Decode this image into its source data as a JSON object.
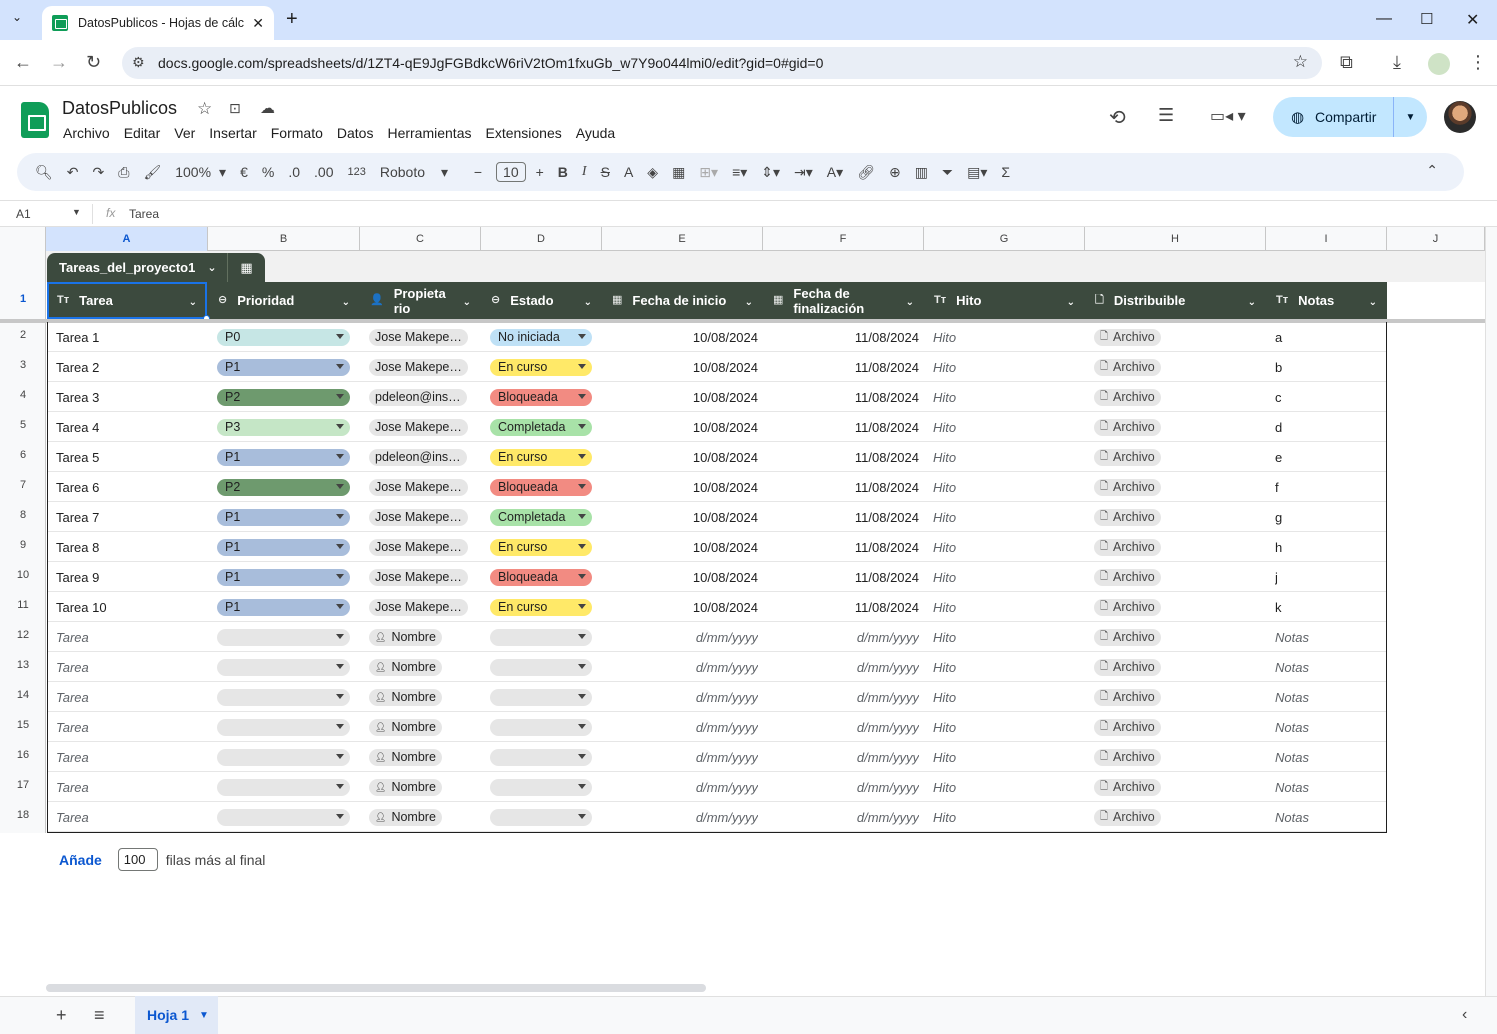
{
  "browser": {
    "tab_title": "DatosPublicos - Hojas de cálcul",
    "new_tab": "+",
    "url": "docs.google.com/spreadsheets/d/1ZT4-qE9JgFGBdkcW6riV2tOm1fxuGb_w7Y9o044lmi0/edit?gid=0#gid=0"
  },
  "doc": {
    "title": "DatosPublicos",
    "menu": [
      "Archivo",
      "Editar",
      "Ver",
      "Insertar",
      "Formato",
      "Datos",
      "Herramientas",
      "Extensiones",
      "Ayuda"
    ],
    "share_label": "Compartir"
  },
  "toolbar": {
    "zoom": "100%",
    "currency": "€",
    "percent": "%",
    "dec_less": ".0",
    "dec_more": ".00",
    "format_num": "123",
    "font": "Roboto",
    "font_size": "10",
    "bold": "B",
    "italic": "I",
    "strike": "S",
    "text_color": "A",
    "sigma": "Σ"
  },
  "formula_bar": {
    "cell_ref": "A1",
    "fx": "fx",
    "value": "Tarea"
  },
  "columns": [
    "A",
    "B",
    "C",
    "D",
    "E",
    "F",
    "G",
    "H",
    "I",
    "J"
  ],
  "rows": [
    "1",
    "2",
    "3",
    "4",
    "5",
    "6",
    "7",
    "8",
    "9",
    "10",
    "11",
    "12",
    "13",
    "14",
    "15",
    "16",
    "17",
    "18"
  ],
  "table": {
    "name": "Tareas_del_proyecto1",
    "headers": [
      "Tarea",
      "Prioridad",
      "Propieta\nrio",
      "Estado",
      "Fecha de inicio",
      "Fecha de\nfinalización",
      "Hito",
      "Distribuible",
      "Notas"
    ],
    "header_icons": [
      "Tт",
      "⊖",
      "👤",
      "⊖",
      "▦",
      "▦",
      "Tт",
      "🗋",
      "Tт"
    ],
    "data": [
      {
        "tarea": "Tarea 1",
        "prioridad": "P0",
        "prop": "Jose Makepe…",
        "estado": "No iniciada",
        "inicio": "10/08/2024",
        "fin": "11/08/2024",
        "hito": "Hito",
        "dist": "Archivo",
        "notas": "a"
      },
      {
        "tarea": "Tarea 2",
        "prioridad": "P1",
        "prop": "Jose Makepe…",
        "estado": "En curso",
        "inicio": "10/08/2024",
        "fin": "11/08/2024",
        "hito": "Hito",
        "dist": "Archivo",
        "notas": "b"
      },
      {
        "tarea": "Tarea 3",
        "prioridad": "P2",
        "prop": "pdeleon@ins…",
        "estado": "Bloqueada",
        "inicio": "10/08/2024",
        "fin": "11/08/2024",
        "hito": "Hito",
        "dist": "Archivo",
        "notas": "c"
      },
      {
        "tarea": "Tarea 4",
        "prioridad": "P3",
        "prop": "Jose Makepe…",
        "estado": "Completada",
        "inicio": "10/08/2024",
        "fin": "11/08/2024",
        "hito": "Hito",
        "dist": "Archivo",
        "notas": "d"
      },
      {
        "tarea": "Tarea 5",
        "prioridad": "P1",
        "prop": "pdeleon@ins…",
        "estado": "En curso",
        "inicio": "10/08/2024",
        "fin": "11/08/2024",
        "hito": "Hito",
        "dist": "Archivo",
        "notas": "e"
      },
      {
        "tarea": "Tarea 6",
        "prioridad": "P2",
        "prop": "Jose Makepe…",
        "estado": "Bloqueada",
        "inicio": "10/08/2024",
        "fin": "11/08/2024",
        "hito": "Hito",
        "dist": "Archivo",
        "notas": "f"
      },
      {
        "tarea": "Tarea 7",
        "prioridad": "P1",
        "prop": "Jose Makepe…",
        "estado": "Completada",
        "inicio": "10/08/2024",
        "fin": "11/08/2024",
        "hito": "Hito",
        "dist": "Archivo",
        "notas": "g"
      },
      {
        "tarea": "Tarea 8",
        "prioridad": "P1",
        "prop": "Jose Makepe…",
        "estado": "En curso",
        "inicio": "10/08/2024",
        "fin": "11/08/2024",
        "hito": "Hito",
        "dist": "Archivo",
        "notas": "h"
      },
      {
        "tarea": "Tarea 9",
        "prioridad": "P1",
        "prop": "Jose Makepe…",
        "estado": "Bloqueada",
        "inicio": "10/08/2024",
        "fin": "11/08/2024",
        "hito": "Hito",
        "dist": "Archivo",
        "notas": "j"
      },
      {
        "tarea": "Tarea 10",
        "prioridad": "P1",
        "prop": "Jose Makepe…",
        "estado": "En curso",
        "inicio": "10/08/2024",
        "fin": "11/08/2024",
        "hito": "Hito",
        "dist": "Archivo",
        "notas": "k"
      }
    ],
    "placeholder": {
      "tarea": "Tarea",
      "prop": "Nombre",
      "date": "d/mm/yyyy",
      "hito": "Hito",
      "dist": "Archivo",
      "notas": "Notas"
    },
    "empty_rows": 7
  },
  "colors": {
    "P0": "#c6e6e5",
    "P1": "#a8bddb",
    "P2": "#6e9a6e",
    "P3": "#c5e6c6",
    "No iniciada": "#bfe1f6",
    "En curso": "#ffe968",
    "Bloqueada": "#f28b82",
    "Completada": "#a8e2a8",
    "empty": "#e6e6e6"
  },
  "footer": {
    "add_label": "Añade",
    "add_count": "100",
    "add_suffix": "filas más al final",
    "sheet_name": "Hoja 1"
  }
}
